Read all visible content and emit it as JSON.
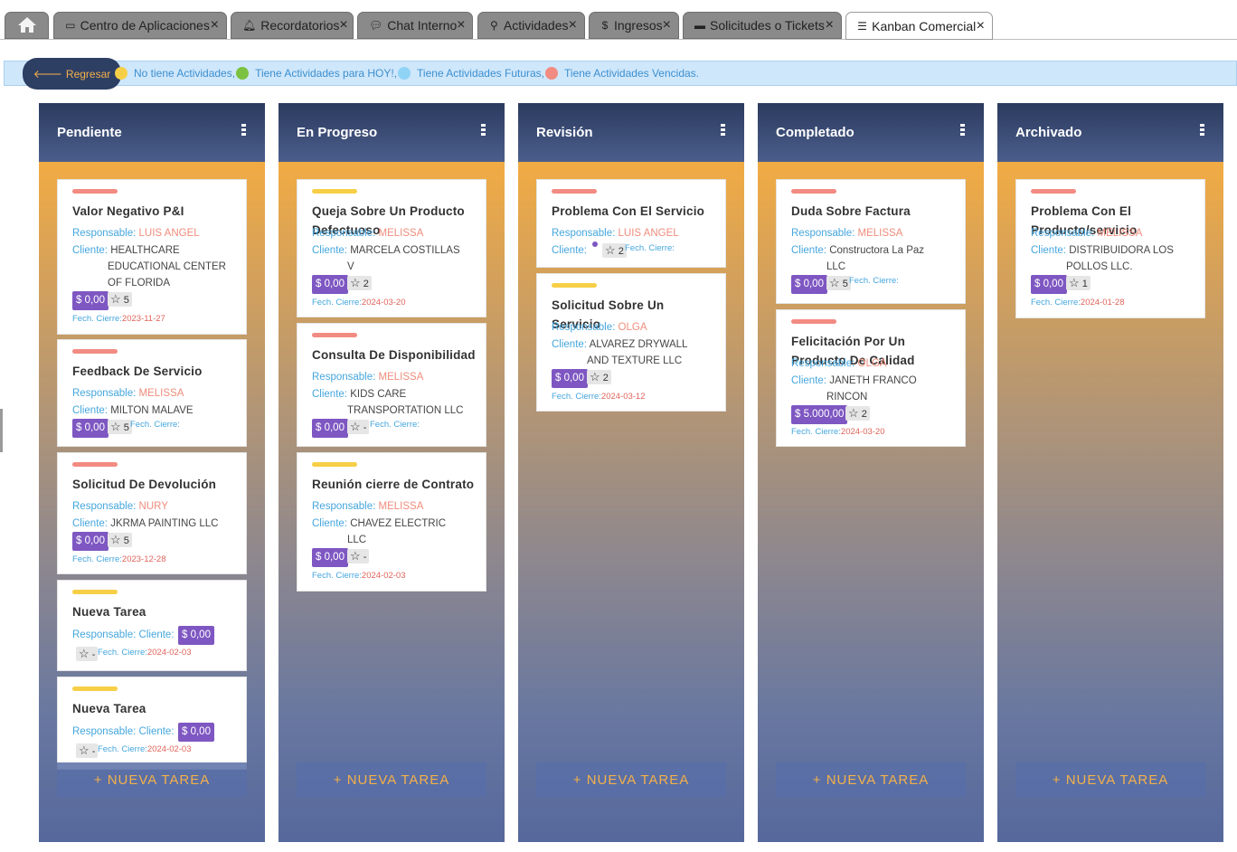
{
  "tabs": [
    {
      "label": "",
      "icon": "home-icon"
    },
    {
      "label": "Centro de Aplicaciones",
      "icon": "apps-icon"
    },
    {
      "label": "Recordatorios",
      "icon": "bell-icon"
    },
    {
      "label": "Chat Interno",
      "icon": "chat-icon"
    },
    {
      "label": "Actividades",
      "icon": "activity-icon"
    },
    {
      "label": "Ingresos",
      "icon": "dollar-icon"
    },
    {
      "label": "Solicitudes o Tickets",
      "icon": "ticket-icon"
    },
    {
      "label": "Kanban Comercial",
      "icon": "list-icon"
    }
  ],
  "close_glyph": "×",
  "back_button": {
    "label": "Regresar",
    "arrow": "🡐"
  },
  "legend": {
    "no_activities": "No tiene Actividades,",
    "today": "Tiene Actividades para HOY!,",
    "future": "Tiene Actividades Futuras,",
    "overdue": "Tiene Actividades Vencidas.",
    "colors": {
      "no_activities": "#f7cf47",
      "today": "#7cc241",
      "future": "#8fd3f5",
      "overdue": "#f28b82"
    }
  },
  "labels": {
    "responsable": "Responsable:",
    "cliente": "Cliente:",
    "cierre": "Fech. Cierre:",
    "new_task": "+ NUEVA TAREA"
  },
  "columns": [
    {
      "title": "Pendiente",
      "cards": [
        {
          "title": "Valor Negativo P&I",
          "responsable": "LUIS ANGEL",
          "cliente": "HEALTHCARE",
          "cliente_cont": [
            "EDUCATIONAL CENTER",
            "OF FLORIDA"
          ],
          "price": "$ 0,00",
          "stars": "5",
          "cierre": "2023-11-27"
        },
        {
          "title": "Feedback De Servicio",
          "responsable": "MELISSA",
          "cliente": "MILTON MALAVE",
          "price": "$ 0,00",
          "stars": "5",
          "cierre": ""
        },
        {
          "title": "Solicitud De Devolución",
          "responsable": "NURY",
          "cliente": "JKRMA PAINTING LLC",
          "price": "$ 0,00",
          "stars": "5",
          "cierre": "2023-12-28"
        },
        {
          "title": "Nueva Tarea",
          "price": "$ 0,00",
          "stars": "-",
          "cierre": "2024-02-03"
        },
        {
          "title": "Nueva Tarea",
          "price": "$ 0,00",
          "stars": "-",
          "cierre": "2024-02-03"
        }
      ]
    },
    {
      "title": "En Progreso",
      "cards": [
        {
          "title": "Queja Sobre Un Producto Defectuoso",
          "responsable": "MELISSA",
          "cliente": "MARCELA COSTILLAS",
          "cliente_cont": [
            "V"
          ],
          "price": "$ 0,00",
          "stars": "2",
          "cierre": "2024-03-20"
        },
        {
          "title": "Consulta De Disponibilidad",
          "responsable": "MELISSA",
          "cliente": "KIDS CARE",
          "cliente_cont": [
            "TRANSPORTATION LLC"
          ],
          "price": "$ 0,00",
          "stars": "-",
          "cierre": ""
        },
        {
          "title": "Reunión cierre de Contrato",
          "responsable": "MELISSA",
          "cliente": "CHAVEZ ELECTRIC",
          "cliente_cont": [
            "LLC"
          ],
          "price": "$ 0,00",
          "stars": "-",
          "cierre": "2024-02-03"
        }
      ]
    },
    {
      "title": "Revisión",
      "cards": [
        {
          "title": "Problema Con El Servicio",
          "responsable": "LUIS ANGEL",
          "cliente": "",
          "stars": "2",
          "cierre": ""
        },
        {
          "title": "Solicitud Sobre Un Servicio",
          "responsable": "OLGA",
          "cliente": "ALVAREZ DRYWALL",
          "cliente_cont": [
            "AND TEXTURE LLC"
          ],
          "price": "$ 0,00",
          "stars": "2",
          "cierre": "2024-03-12"
        }
      ]
    },
    {
      "title": "Completado",
      "cards": [
        {
          "title": "Duda Sobre Factura",
          "responsable": "MELISSA",
          "cliente": "Constructora La Paz",
          "cliente_cont": [
            "LLC"
          ],
          "price": "$ 0,00",
          "stars": "5",
          "cierre": ""
        },
        {
          "title": "Felicitación Por Un Producto De Calidad",
          "responsable": "OLGA",
          "cliente": "JANETH FRANCO",
          "cliente_cont": [
            "RINCON"
          ],
          "price": "$ 5.000,00",
          "stars": "2",
          "cierre": "2024-03-20"
        }
      ]
    },
    {
      "title": "Archivado",
      "cards": [
        {
          "title": "Problema Con El Producto/servicio",
          "responsable": "MELISSA",
          "cliente": "DISTRIBUIDORA LOS",
          "cliente_cont": [
            "POLLOS LLC."
          ],
          "price": "$ 0,00",
          "stars": "1",
          "cierre": "2024-01-28"
        }
      ]
    }
  ]
}
